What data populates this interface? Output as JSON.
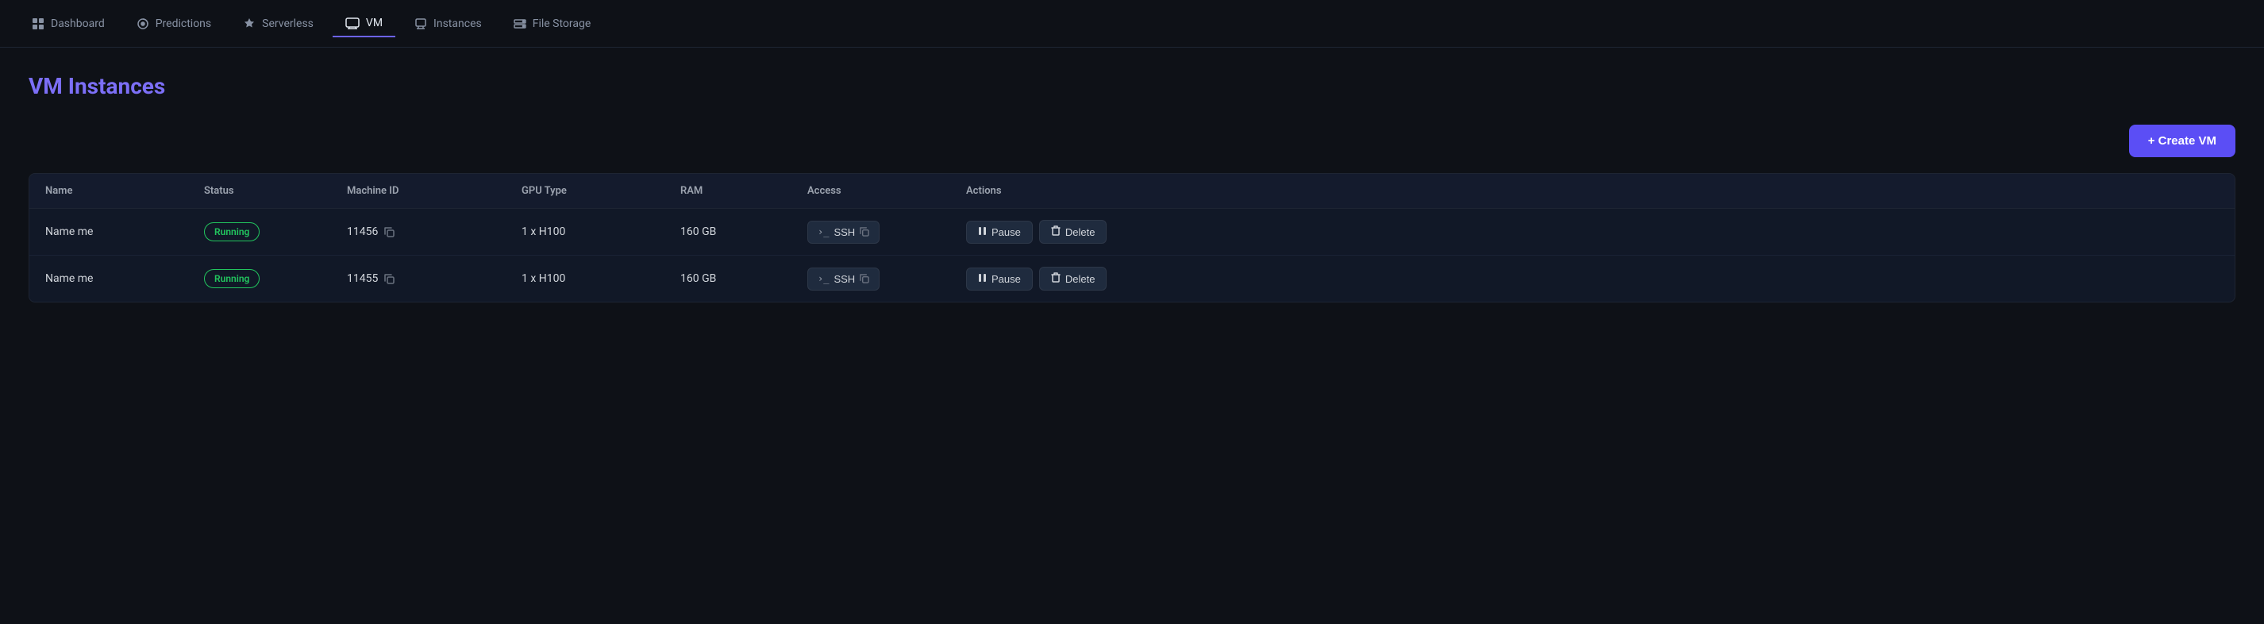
{
  "nav": {
    "items": [
      {
        "id": "dashboard",
        "label": "Dashboard",
        "icon": "⊞",
        "active": false
      },
      {
        "id": "predictions",
        "label": "Predictions",
        "icon": "◑",
        "active": false
      },
      {
        "id": "serverless",
        "label": "Serverless",
        "icon": "🚀",
        "active": false
      },
      {
        "id": "vm",
        "label": "VM",
        "icon": "▭",
        "active": true
      },
      {
        "id": "instances",
        "label": "Instances",
        "icon": "🗂",
        "active": false
      },
      {
        "id": "file-storage",
        "label": "File Storage",
        "icon": "🗄",
        "active": false
      }
    ]
  },
  "page": {
    "title": "VM Instances"
  },
  "toolbar": {
    "create_button_label": "+ Create VM"
  },
  "table": {
    "headers": [
      "Name",
      "Status",
      "Machine ID",
      "GPU Type",
      "RAM",
      "Access",
      "Actions"
    ],
    "rows": [
      {
        "name": "Name me",
        "status": "Running",
        "machine_id": "11456",
        "gpu_type": "1 x H100",
        "ram": "160 GB",
        "access": "SSH",
        "pause_label": "Pause",
        "delete_label": "Delete"
      },
      {
        "name": "Name me",
        "status": "Running",
        "machine_id": "11455",
        "gpu_type": "1 x H100",
        "ram": "160 GB",
        "access": "SSH",
        "pause_label": "Pause",
        "delete_label": "Delete"
      }
    ]
  },
  "icons": {
    "dashboard": "⊞",
    "predictions": "◐",
    "serverless": "◇",
    "vm": "▭",
    "instances": "❏",
    "file_storage": "🗄",
    "copy": "⧉",
    "terminal": ">_",
    "pause": "⏸",
    "trash": "🗑"
  }
}
